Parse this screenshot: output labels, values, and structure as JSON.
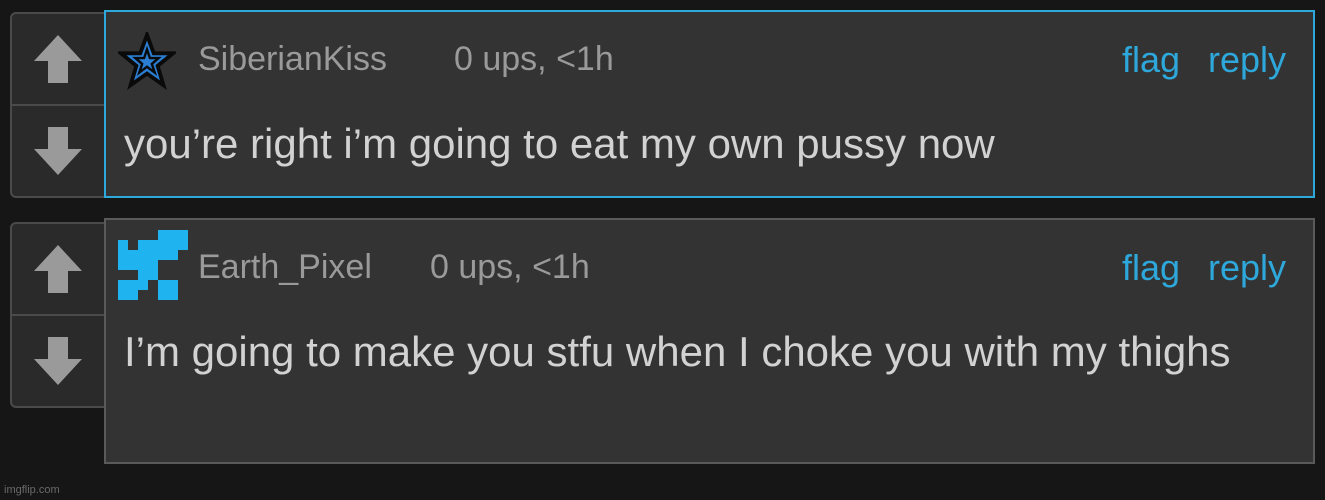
{
  "comments": [
    {
      "username": "SiberianKiss",
      "meta": "0 ups, <1h",
      "flag_label": "flag",
      "reply_label": "reply",
      "text": "you’re right i’m going to eat my own pussy now",
      "avatar_icon": "star-icon",
      "accent": "#2ea8db"
    },
    {
      "username": "Earth_Pixel",
      "meta": "0 ups, <1h",
      "flag_label": "flag",
      "reply_label": "reply",
      "text": "I’m going to make you stfu when I choke you with my thighs",
      "avatar_icon": "pixel-avatar-icon",
      "accent": "#1fb4f0"
    }
  ],
  "watermark": "imgflip.com"
}
